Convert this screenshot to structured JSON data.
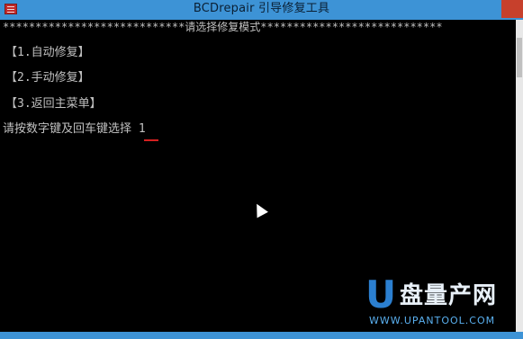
{
  "window": {
    "title": "BCDrepair 引导修复工具"
  },
  "console": {
    "header": "****************************请选择修复模式****************************",
    "menu_items": [
      {
        "label": "【1.自动修复】"
      },
      {
        "label": "【2.手动修复】"
      },
      {
        "label": "【3.返回主菜单】"
      }
    ],
    "prompt": "请按数字键及回车键选择 1"
  },
  "watermark": {
    "logo_letter": "U",
    "logo_text": "盘量产网",
    "url": "WWW.UPANTOOL.COM"
  },
  "colors": {
    "titlebar": "#3d93d6",
    "console_bg": "#000000",
    "console_text": "#c0c0c0",
    "cursor_mark": "#d42020",
    "watermark_blue": "#2b7fd0"
  }
}
